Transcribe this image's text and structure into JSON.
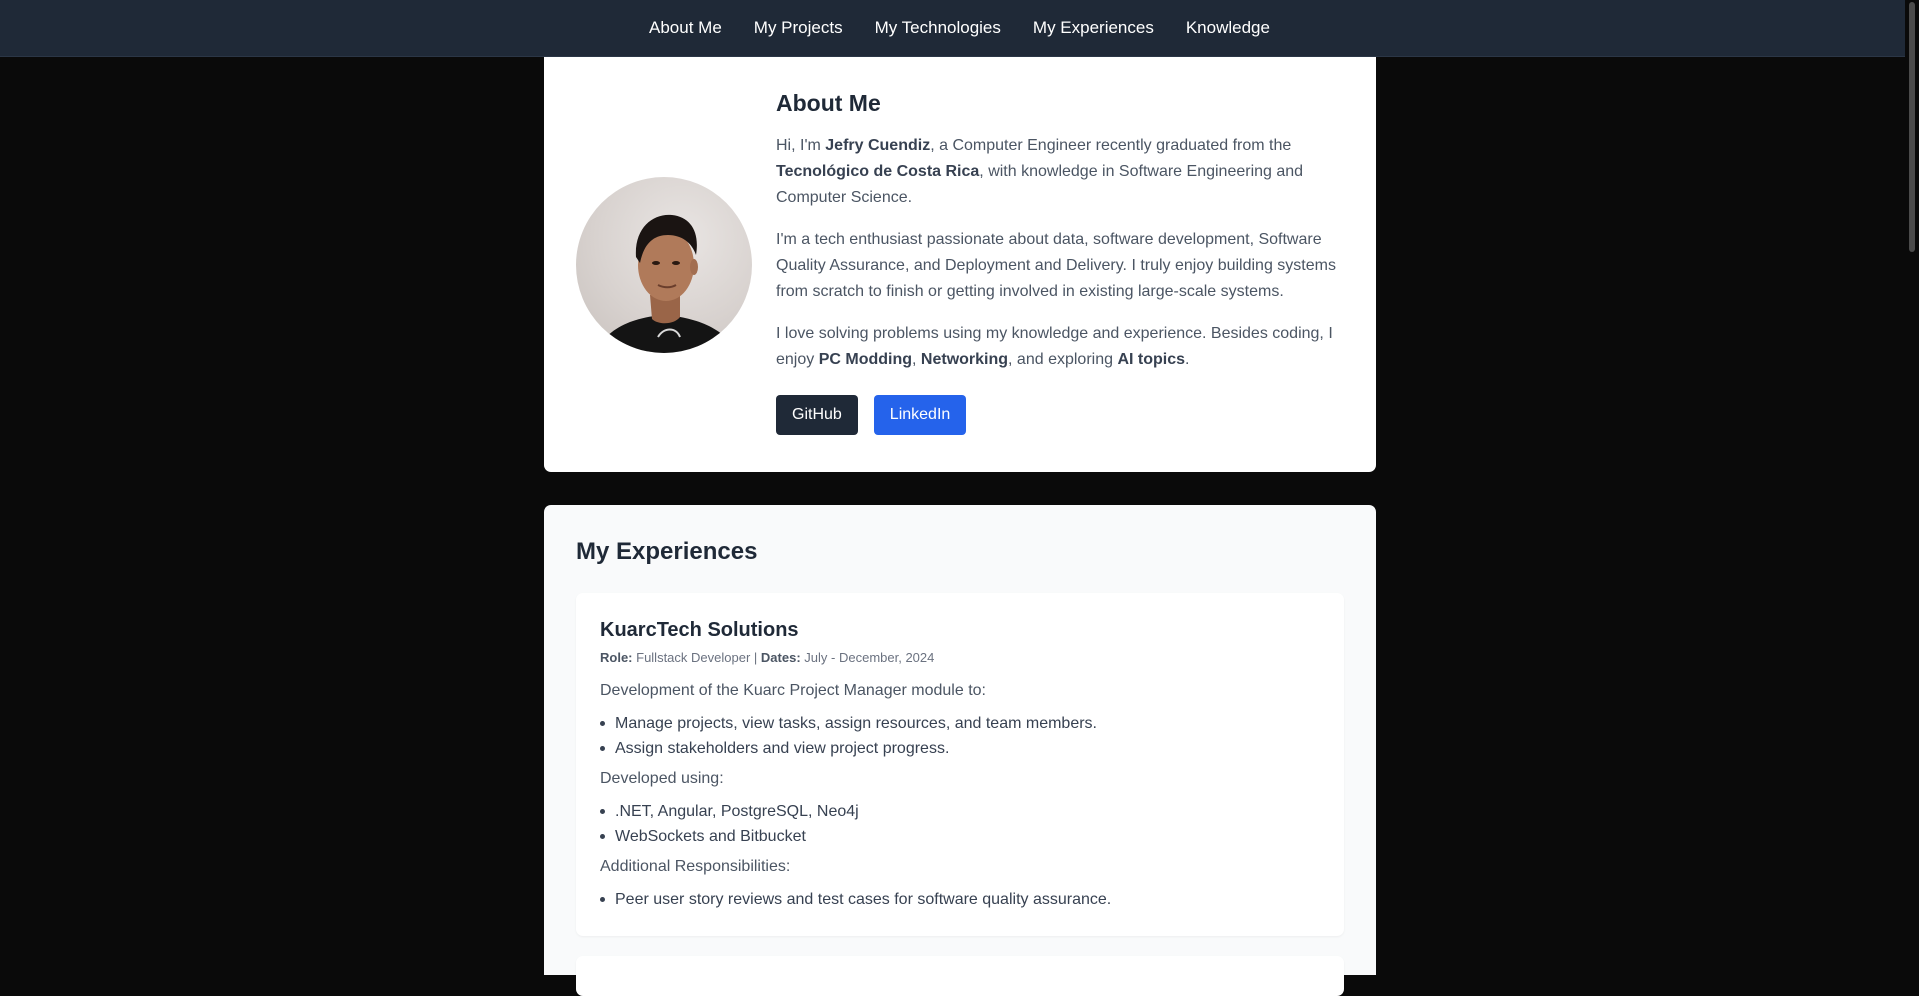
{
  "nav": {
    "items": [
      "About Me",
      "My Projects",
      "My Technologies",
      "My Experiences",
      "Knowledge"
    ]
  },
  "about": {
    "title": "About Me",
    "p1": {
      "a": "Hi, I'm ",
      "name": "Jefry Cuendiz",
      "b": ", a Computer Engineer recently graduated from the ",
      "school": "Tecnológico de Costa Rica",
      "c": ", with knowledge in Software Engineering and Computer Science."
    },
    "p2": "I'm a tech enthusiast passionate about data, software development, Software Quality Assurance, and Deployment and Delivery. I truly enjoy building systems from scratch to finish or getting involved in existing large-scale systems.",
    "p3": {
      "a": "I love solving problems using my knowledge and experience. Besides coding, I enjoy ",
      "h1": "PC Modding",
      "b": ", ",
      "h2": "Networking",
      "c": ", and exploring ",
      "h3": "AI topics",
      "d": "."
    },
    "buttons": {
      "github": "GitHub",
      "linkedin": "LinkedIn"
    }
  },
  "experiences": {
    "title": "My Experiences",
    "items": [
      {
        "company": "KuarcTech Solutions",
        "role_label": "Role:",
        "role": "Fullstack Developer",
        "separator": "|",
        "dates_label": "Dates:",
        "dates": "July - December, 2024",
        "intro": "Development of the Kuarc Project Manager module to:",
        "bullets1": [
          "Manage projects, view tasks, assign resources, and team members.",
          "Assign stakeholders and view project progress."
        ],
        "developed_label": "Developed using:",
        "bullets2": [
          ".NET, Angular, PostgreSQL, Neo4j",
          "WebSockets and Bitbucket"
        ],
        "additional_label": "Additional Responsibilities:",
        "bullets3": [
          "Peer user story reviews and test cases for software quality assurance."
        ]
      }
    ]
  },
  "colors": {
    "nav_bg": "#1f2937",
    "page_bg": "#0a0a0a",
    "github_btn": "#1f2937",
    "linkedin_btn": "#2563eb"
  }
}
